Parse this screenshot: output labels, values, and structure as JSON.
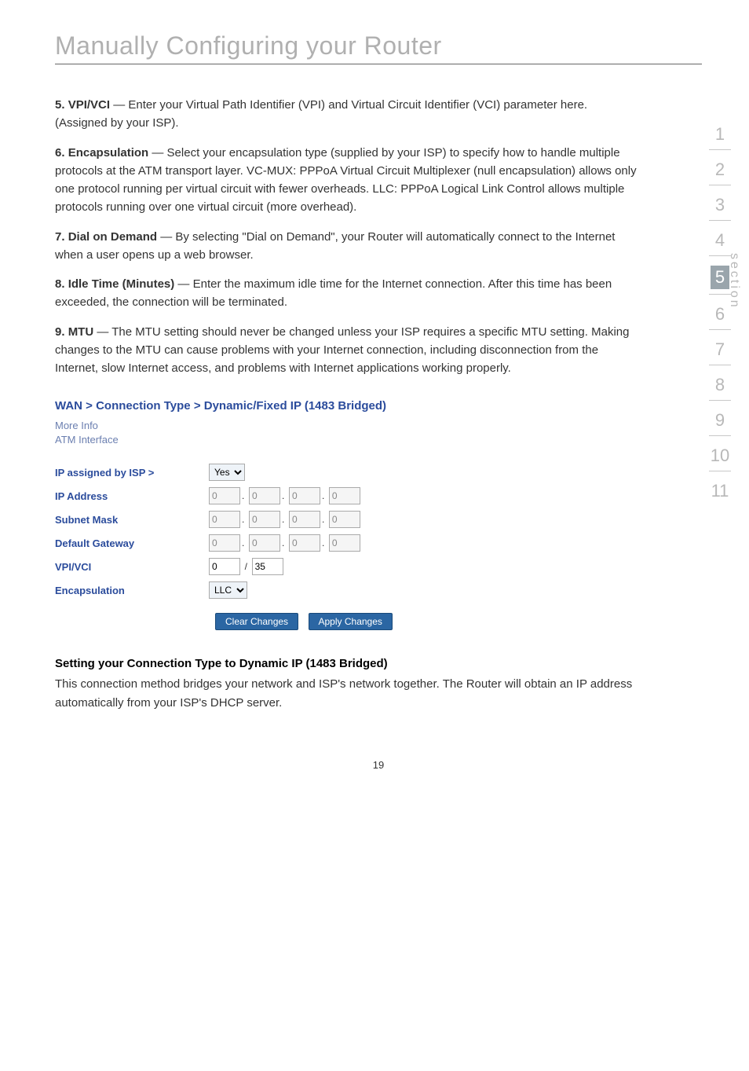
{
  "page": {
    "title": "Manually Configuring your Router",
    "number": "19"
  },
  "items": [
    {
      "num": "5.",
      "term": "VPI/VCI",
      "text": " — Enter your Virtual Path Identifier (VPI) and Virtual Circuit Identifier (VCI) parameter here. (Assigned by your ISP)."
    },
    {
      "num": "6.",
      "term": "Encapsulation",
      "text": " — Select your encapsulation type (supplied by your ISP) to specify how to handle multiple protocols at the ATM transport layer. VC-MUX: PPPoA Virtual Circuit Multiplexer (null encapsulation) allows only one protocol running per virtual circuit with fewer overheads. LLC: PPPoA Logical Link Control allows multiple protocols running over one virtual circuit (more overhead)."
    },
    {
      "num": "7.",
      "term": "Dial on Demand",
      "text": " — By selecting \"Dial on Demand\", your Router will automatically connect to the Internet when a user opens up a web browser."
    },
    {
      "num": "8.",
      "term": "Idle Time (Minutes)",
      "text": " — Enter the maximum idle time for the Internet connection. After this time has been exceeded, the connection will be terminated."
    },
    {
      "num": "9.",
      "term": "MTU",
      "text": " — The MTU setting should never be changed unless your ISP requires a specific MTU setting. Making changes to the MTU can cause problems with your Internet connection, including disconnection from the Internet, slow Internet access, and problems with Internet applications working properly."
    }
  ],
  "wan": {
    "section_title": "WAN > Connection Type > Dynamic/Fixed IP (1483 Bridged)",
    "more_info_line1": "More Info",
    "more_info_line2": "ATM Interface",
    "labels": {
      "ip_assigned": "IP assigned by ISP >",
      "ip_address": "IP Address",
      "subnet_mask": "Subnet Mask",
      "default_gateway": "Default Gateway",
      "vpi_vci": "VPI/VCI",
      "encapsulation": "Encapsulation"
    },
    "values": {
      "ip_assigned_select": "Yes",
      "ip_oct": [
        "0",
        "0",
        "0",
        "0"
      ],
      "mask_oct": [
        "0",
        "0",
        "0",
        "0"
      ],
      "gw_oct": [
        "0",
        "0",
        "0",
        "0"
      ],
      "vpi": "0",
      "vci": "35",
      "encap_select": "LLC"
    },
    "buttons": {
      "clear": "Clear Changes",
      "apply": "Apply Changes"
    }
  },
  "bottom": {
    "subhead": "Setting your Connection Type to Dynamic IP (1483 Bridged)",
    "para": "This connection method bridges your network and ISP's network together. The Router will obtain an IP address automatically from your ISP's DHCP server."
  },
  "sidebar": {
    "label": "section",
    "nums": [
      "1",
      "2",
      "3",
      "4",
      "5",
      "6",
      "7",
      "8",
      "9",
      "10",
      "11"
    ],
    "active_index": 4
  }
}
